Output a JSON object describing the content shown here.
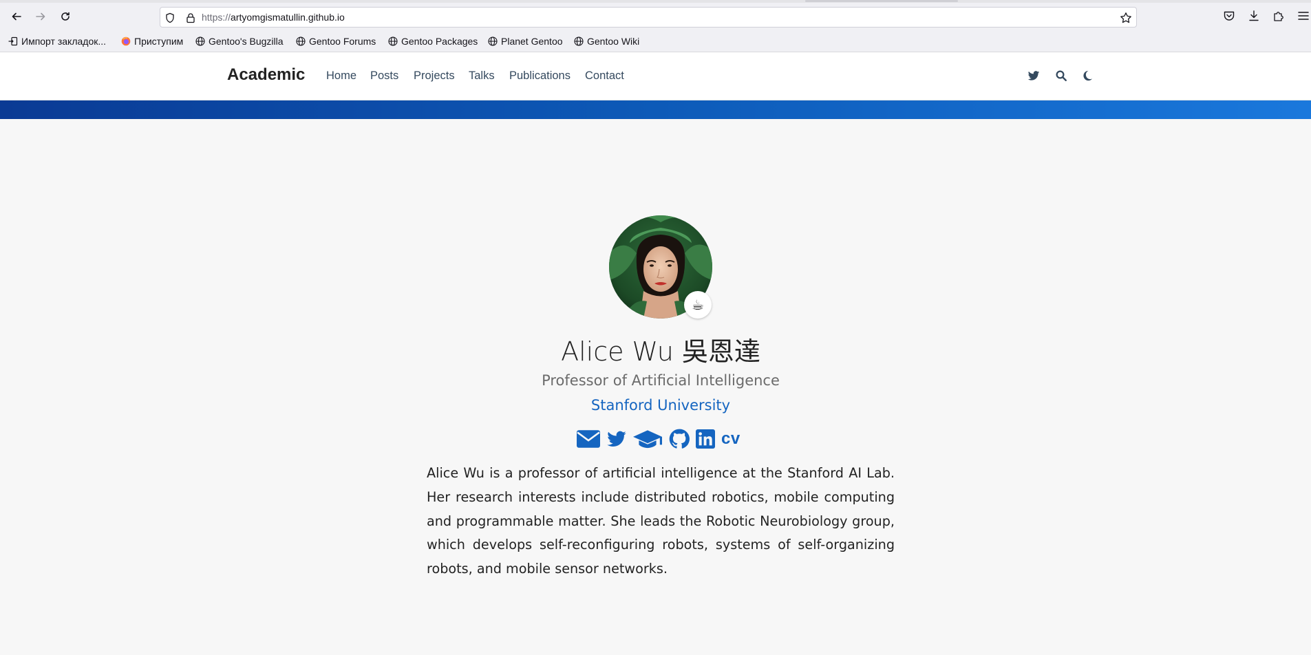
{
  "browser": {
    "url_scheme": "https://",
    "url_host": "artyomgismatullin.github.io"
  },
  "bookmarks": [
    {
      "label": "Импорт закладок..."
    },
    {
      "label": "Приступим"
    },
    {
      "label": "Gentoo's Bugzilla"
    },
    {
      "label": "Gentoo Forums"
    },
    {
      "label": "Gentoo Packages"
    },
    {
      "label": "Planet Gentoo"
    },
    {
      "label": "Gentoo Wiki"
    }
  ],
  "site": {
    "brand": "Academic",
    "menu": [
      {
        "label": "Home"
      },
      {
        "label": "Posts"
      },
      {
        "label": "Projects"
      },
      {
        "label": "Talks"
      },
      {
        "label": "Publications"
      },
      {
        "label": "Contact"
      }
    ],
    "nav_icons": [
      "twitter-icon",
      "search-icon",
      "moon-icon"
    ]
  },
  "profile": {
    "status_emoji": "☕",
    "name": "Alice Wu 吳恩達",
    "role": "Professor of Artificial Intelligence",
    "organization": "Stanford University",
    "social_icons": [
      "envelope-icon",
      "twitter-icon",
      "graduation-cap-icon",
      "github-icon",
      "linkedin-icon"
    ],
    "cv_label": "cv",
    "bio": "Alice Wu is a professor of artificial intelligence at the Stanford AI Lab. Her research interests include distributed robotics, mobile computing and programmable matter. She leads the Robotic Neurobiology group, which develops self-reconfiguring robots, systems of self-organizing robots, and mobile sensor networks."
  },
  "colors": {
    "accent": "#1565c0",
    "hero_band_start": "#0a3a94",
    "hero_band_end": "#1a78dc",
    "page_bg": "#f7f7f7"
  }
}
